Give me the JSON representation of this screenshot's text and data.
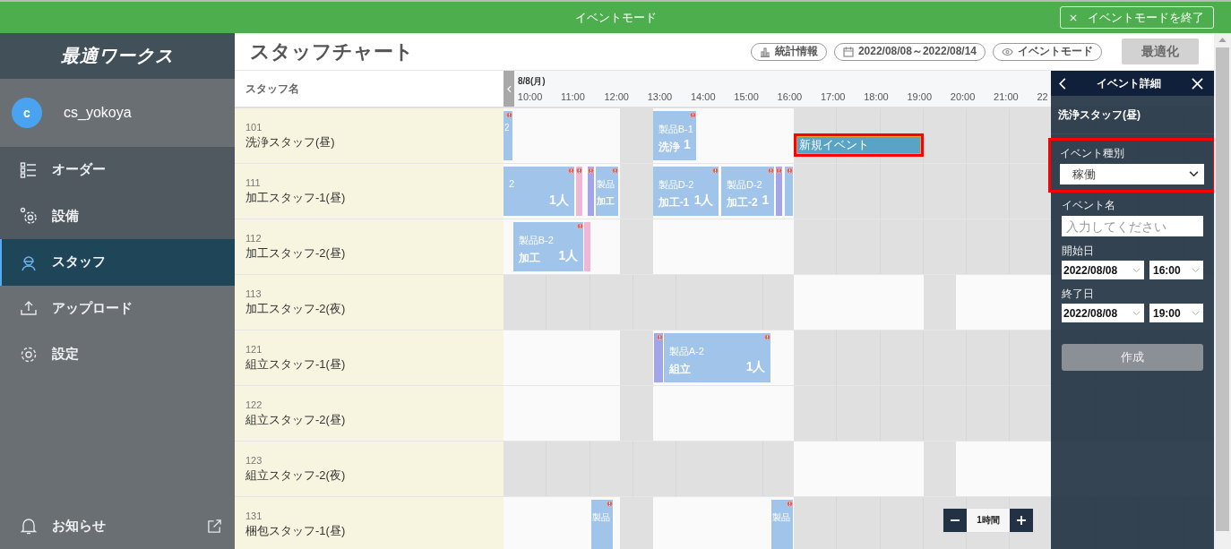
{
  "mode_bar": {
    "title": "イベントモード",
    "exit_button": "イベントモードを終了"
  },
  "sidebar": {
    "logo": "最適ワークス",
    "user": {
      "initial": "c",
      "name": "cs_yokoya"
    },
    "items": [
      {
        "label": "オーダー",
        "selected": false
      },
      {
        "label": "設備",
        "selected": false
      },
      {
        "label": "スタッフ",
        "selected": true
      },
      {
        "label": "アップロード",
        "selected": false
      },
      {
        "label": "設定",
        "selected": false
      }
    ],
    "footer": {
      "label": "お知らせ"
    }
  },
  "header": {
    "title": "スタッフチャート",
    "buttons": [
      "統計情報",
      "2022/08/08～2022/08/14",
      "イベントモード"
    ],
    "optimize": {
      "label": "最適化",
      "disabled": true
    }
  },
  "chart": {
    "name_column": "スタッフ名",
    "date": "8/8(月)",
    "hours": [
      "10:00",
      "11:00",
      "12:00",
      "13:00",
      "14:00",
      "15:00",
      "16:00",
      "17:00",
      "18:00",
      "19:00",
      "20:00",
      "21:00",
      "22"
    ],
    "rows": [
      {
        "code": "101",
        "name": "洗浄スタッフ(昼)",
        "night_shift": false,
        "blocks": [
          {
            "color": "#a0c4ea",
            "alert": true,
            "product": "2"
          },
          {
            "color": "#a0c4ea",
            "alert": true,
            "product": "製品B-1",
            "process": "洗浄",
            "count": "1"
          }
        ],
        "event": {
          "label": "新規イベント",
          "highlighted": true
        }
      },
      {
        "code": "111",
        "name": "加工スタッフ-1(昼)",
        "night_shift": false,
        "blocks": [
          {
            "color": "#a0c4ea",
            "alert": true,
            "product": "2",
            "count": "1人"
          },
          {
            "color": "#f0b6d6",
            "alert": true
          },
          {
            "color": "#a2a6e8",
            "alert": true
          },
          {
            "color": "#a0c4ea",
            "alert": true,
            "product": "製品",
            "process": "加工"
          },
          {
            "color": "#a0c4ea",
            "alert": true,
            "product": "製品D-2",
            "process": "加工-1",
            "count": "1人"
          },
          {
            "color": "#a0c4ea",
            "alert": true,
            "product": "製品D-2",
            "process": "加工-2",
            "count": "1"
          },
          {
            "color": "#a2a6e8",
            "alert": true
          },
          {
            "color": "#a0c4ea",
            "alert": true
          }
        ]
      },
      {
        "code": "112",
        "name": "加工スタッフ-2(昼)",
        "night_shift": false,
        "blocks": [
          {
            "color": "#a0c4ea",
            "alert": true,
            "product": "製品B-2",
            "process": "加工",
            "count": "1人"
          },
          {
            "color": "#f0b6d6",
            "alert": false
          }
        ]
      },
      {
        "code": "113",
        "name": "加工スタッフ-2(夜)",
        "night_shift": true,
        "blocks": []
      },
      {
        "code": "121",
        "name": "組立スタッフ-1(昼)",
        "night_shift": false,
        "blocks": [
          {
            "color": "#a2a6e8",
            "alert": true
          },
          {
            "color": "#a0c4ea",
            "alert": true,
            "product": "製品A-2",
            "process": "組立",
            "count": "1人"
          }
        ]
      },
      {
        "code": "122",
        "name": "組立スタッフ-2(昼)",
        "night_shift": false,
        "blocks": []
      },
      {
        "code": "123",
        "name": "組立スタッフ-2(夜)",
        "night_shift": true,
        "blocks": []
      },
      {
        "code": "131",
        "name": "梱包スタッフ-1(昼)",
        "night_shift": false,
        "blocks": [
          {
            "color": "#a0c4ea",
            "alert": true,
            "product": "製品"
          },
          {
            "color": "#a0c4ea",
            "alert": true,
            "product": "製品"
          }
        ]
      }
    ],
    "zoom": {
      "label": "1時間"
    }
  },
  "panel": {
    "title": "イベント詳細",
    "staff": "洗浄スタッフ(昼)",
    "event_type": {
      "label": "イベント種別",
      "value": "稼働",
      "highlighted": true
    },
    "event_name": {
      "label": "イベント名",
      "placeholder": "入力してください"
    },
    "start": {
      "label": "開始日",
      "date": "2022/08/08",
      "time": "16:00"
    },
    "end": {
      "label": "終了日",
      "date": "2022/08/08",
      "time": "19:00"
    },
    "submit": {
      "label": "作成",
      "disabled": true
    }
  }
}
